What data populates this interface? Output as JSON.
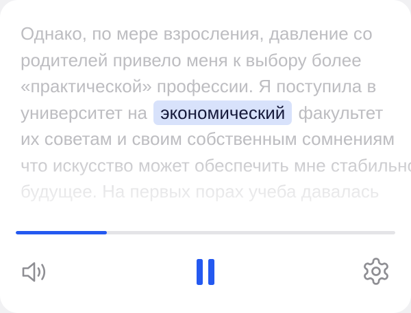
{
  "reader": {
    "lines": [
      {
        "text": "Однако, по мере взросления, давление со"
      },
      {
        "text": "родителей привело меня к выбору более"
      },
      {
        "text": "«практической» профессии. Я поступила в"
      },
      {
        "before": "университет на ",
        "highlight": "экономический",
        "after": " факультет"
      },
      {
        "text": "их советам и своим собственным сомнениям"
      },
      {
        "text": "что искусство может обеспечить мне стабильное"
      },
      {
        "text": "будущее. На первых порах учеба давалась"
      }
    ]
  },
  "player": {
    "progress": 0.24,
    "volume_icon": "volume-icon",
    "pause_icon": "pause-icon",
    "settings_icon": "gear-icon",
    "accent_color": "#2459f0",
    "highlight_color": "#d8e2fb"
  }
}
